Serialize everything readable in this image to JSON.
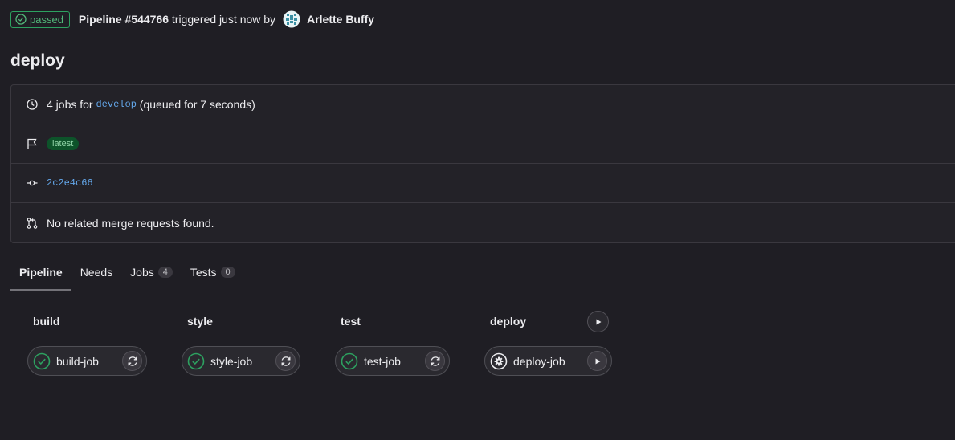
{
  "header": {
    "status_label": "passed",
    "pipeline_label": "Pipeline #544766",
    "triggered_text": "triggered just now by",
    "author": "Arlette Buffy"
  },
  "page_title": "deploy",
  "info": {
    "jobs_count_text": "4 jobs for",
    "branch": "develop",
    "queued_text": "(queued for 7 seconds)",
    "tag": "latest",
    "commit": "2c2e4c66",
    "merge_requests_text": "No related merge requests found."
  },
  "tabs": [
    {
      "label": "Pipeline",
      "count": null
    },
    {
      "label": "Needs",
      "count": null
    },
    {
      "label": "Jobs",
      "count": "4"
    },
    {
      "label": "Tests",
      "count": "0"
    }
  ],
  "stages": [
    {
      "name": "build",
      "job": "build-job",
      "status": "success",
      "action": "retry-icon"
    },
    {
      "name": "style",
      "job": "style-job",
      "status": "success",
      "action": "retry-icon"
    },
    {
      "name": "test",
      "job": "test-job",
      "status": "success",
      "action": "retry-icon"
    },
    {
      "name": "deploy",
      "job": "deploy-job",
      "status": "manual",
      "action": "play-icon"
    }
  ],
  "colors": {
    "background": "#1f1e24",
    "success": "#2da160",
    "link": "#63a6e9"
  }
}
